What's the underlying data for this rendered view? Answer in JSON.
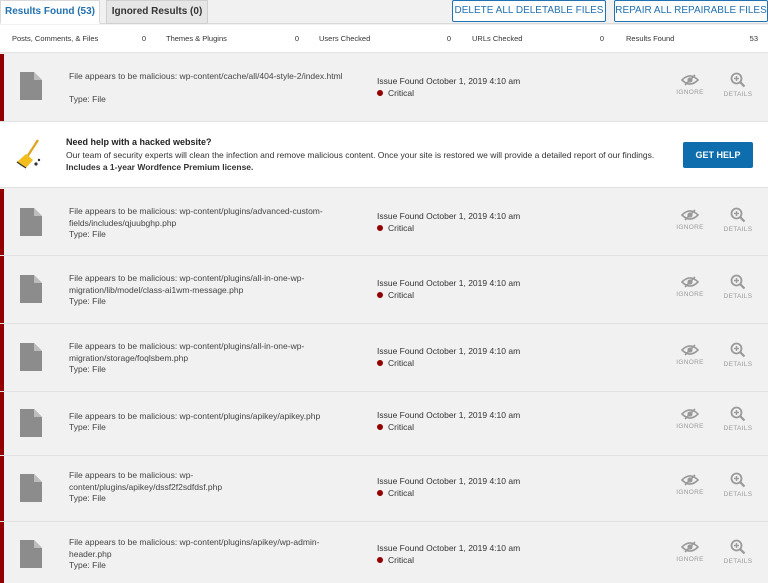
{
  "tabs": [
    {
      "label": "Results Found (53)"
    },
    {
      "label": "Ignored Results (0)"
    }
  ],
  "actions": {
    "delete_label": "DELETE ALL DELETABLE FILES",
    "repair_label": "REPAIR ALL REPAIRABLE FILES"
  },
  "stats": [
    {
      "label": "Posts, Comments, & Files",
      "value": "0"
    },
    {
      "label": "Themes & Plugins",
      "value": "0"
    },
    {
      "label": "Users Checked",
      "value": "0"
    },
    {
      "label": "URLs Checked",
      "value": "0"
    },
    {
      "label": "Results Found",
      "value": "53"
    }
  ],
  "help_banner": {
    "heading": "Need help with a hacked website?",
    "text": "Our team of security experts will clean the infection and remove malicious content. Once your site is restored we will provide a detailed report of our findings.",
    "text_bold": "Includes a 1-year Wordfence Premium license.",
    "button_label": "GET HELP"
  },
  "issue_labels": {
    "ignore": "IGNORE",
    "details": "DETAILS"
  },
  "issues": [
    {
      "title": "File appears to be malicious: wp-content/cache/all/404-style-2/index.html",
      "type": "Type: File",
      "found": "Issue Found October 1, 2019 4:10 am",
      "severity": "Critical"
    },
    {
      "title": "File appears to be malicious: wp-content/plugins/advanced-custom-fields/includes/qjuubghp.php",
      "type": "Type: File",
      "found": "Issue Found October 1, 2019 4:10 am",
      "severity": "Critical"
    },
    {
      "title": "File appears to be malicious: wp-content/plugins/all-in-one-wp-migration/lib/model/class-ai1wm-message.php",
      "type": "Type: File",
      "found": "Issue Found October 1, 2019 4:10 am",
      "severity": "Critical"
    },
    {
      "title": "File appears to be malicious: wp-content/plugins/all-in-one-wp-migration/storage/foqlsbem.php",
      "type": "Type: File",
      "found": "Issue Found October 1, 2019 4:10 am",
      "severity": "Critical"
    },
    {
      "title": "File appears to be malicious: wp-content/plugins/apikey/apikey.php",
      "type": "Type: File",
      "found": "Issue Found October 1, 2019 4:10 am",
      "severity": "Critical"
    },
    {
      "title": "File appears to be malicious: wp-content/plugins/apikey/dssf2f2sdfdsf.php",
      "type": "Type: File",
      "found": "Issue Found October 1, 2019 4:10 am",
      "severity": "Critical"
    },
    {
      "title": "File appears to be malicious: wp-content/plugins/apikey/wp-admin-header.php",
      "type": "Type: File",
      "found": "Issue Found October 1, 2019 4:10 am",
      "severity": "Critical"
    }
  ]
}
